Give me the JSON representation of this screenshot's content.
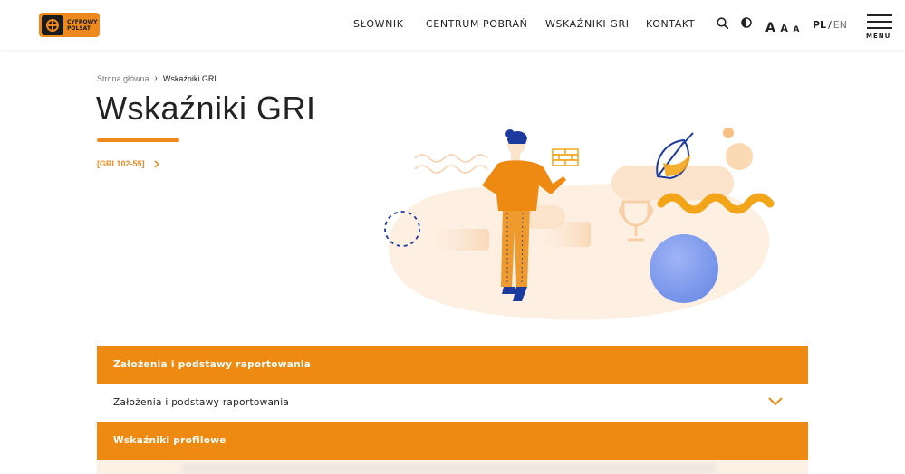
{
  "header": {
    "logo_text": [
      "CYFROWY",
      "POLSAT"
    ],
    "nav": [
      "SŁOWNIK",
      "CENTRUM POBRAŃ",
      "WSKAŹNIKI GRI",
      "KONTAKT"
    ],
    "font_size_labels": [
      "A",
      "A",
      "A"
    ],
    "lang_active": "PL",
    "lang_sep": "/",
    "lang_other": "EN",
    "menu_label": "MENU"
  },
  "breadcrumb": {
    "home": "Strona główna",
    "separator": "›",
    "current": "Wskaźniki GRI"
  },
  "page": {
    "title": "Wskaźniki GRI",
    "gri_link": "[GRI 102-55]"
  },
  "accordion": [
    {
      "label": "Założenia i podstawy raportowania",
      "style": "orange"
    },
    {
      "label": "Założenia i podstawy raportowania",
      "style": "white",
      "expandable": true
    },
    {
      "label": "Wskaźniki profilowe",
      "style": "orange"
    }
  ],
  "colors": {
    "accent": "#ee8a12",
    "text": "#222222",
    "blue": "#1d3a9e"
  },
  "icons": [
    "search-icon",
    "contrast-icon",
    "chevron-right-icon",
    "chevron-down-icon",
    "hamburger-icon"
  ]
}
